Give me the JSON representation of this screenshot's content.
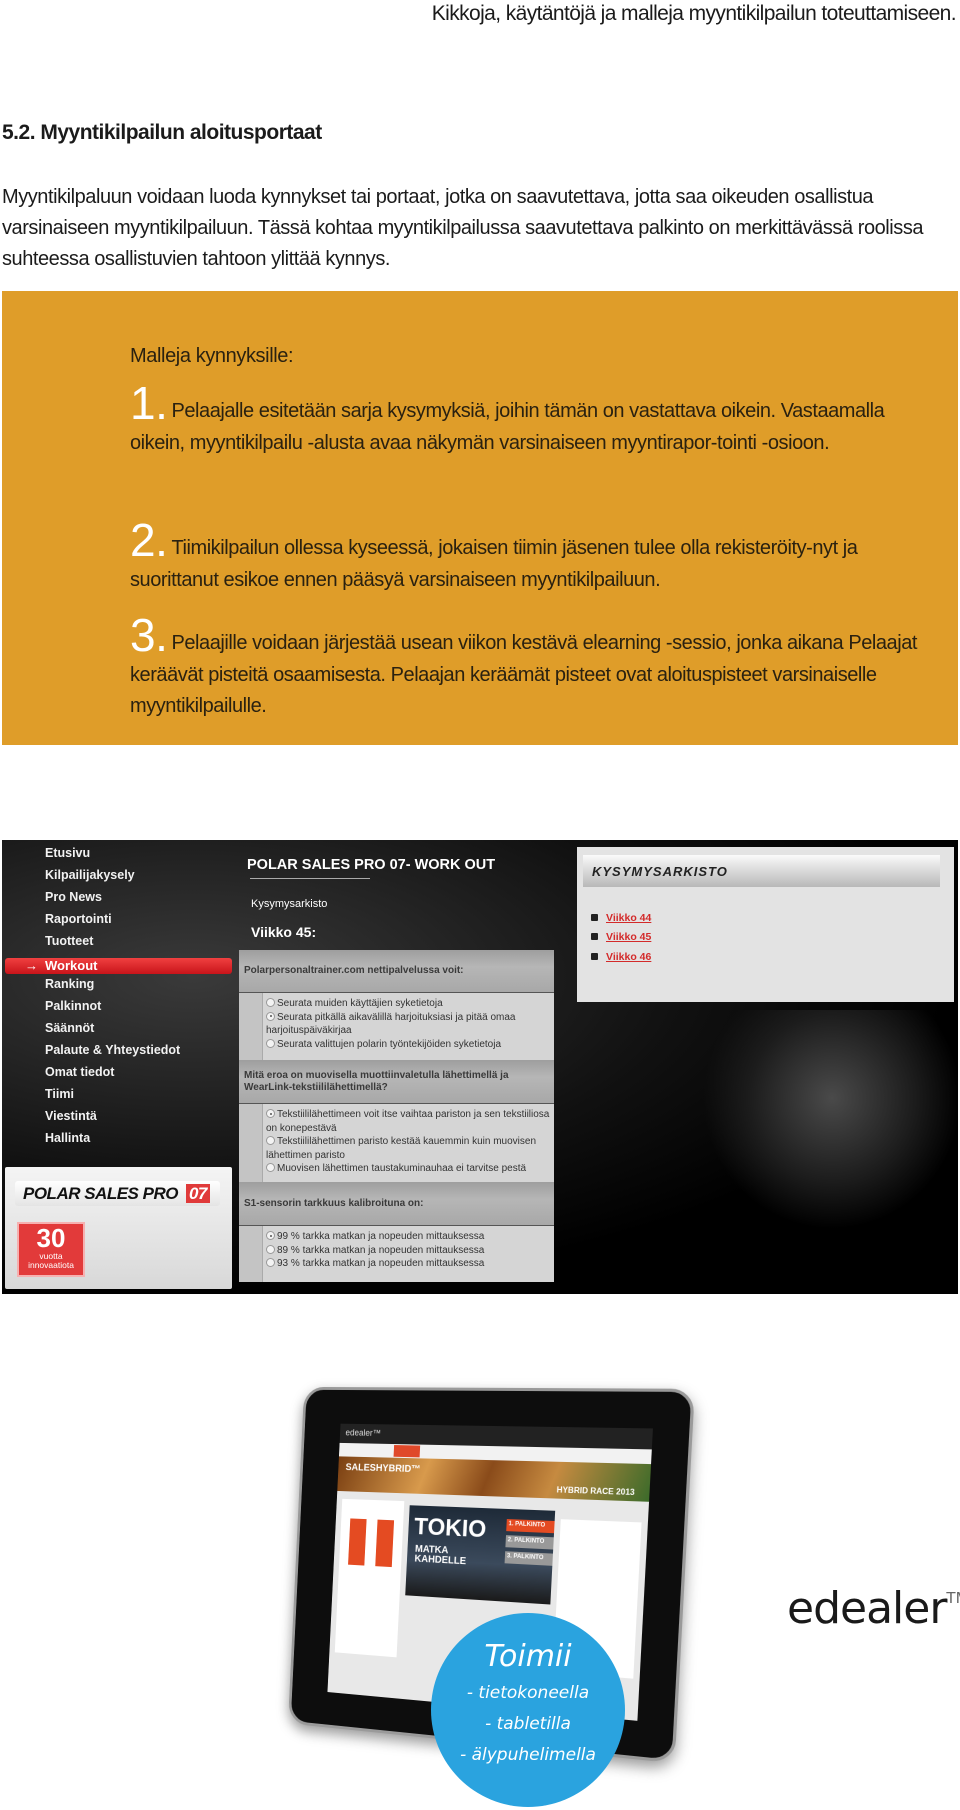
{
  "running_header": "Kikkoja, käytäntöjä ja malleja myyntikilpailun toteuttamiseen.",
  "section_heading": "5.2. Myyntikilpailun aloitusportaat",
  "intro": "Myyntikilpaluun voidaan luoda kynnykset tai portaat, jotka on saavutettava, jotta saa oikeuden osallistua varsinaiseen myyntikilpailuun. Tässä kohtaa myyntikilpailussa saavutettava palkinto on merkittävässä roolissa suhteessa osallistuvien tahtoon ylittää kynnys.",
  "box": {
    "color": "#DF9D29",
    "lead": "Malleja kynnyksille:",
    "items": [
      {
        "num": "1.",
        "text": "Pelaajalle esitetään sarja kysymyksiä, joihin tämän on vastattava oikein. Vastaamalla oikein, myyntikilpailu -alusta avaa näkymän varsinaiseen myyntirapor-tointi -osioon."
      },
      {
        "num": "2.",
        "text": "Tiimikilpailun ollessa kyseessä, jokaisen tiimin jäsenen tulee olla rekisteröity-nyt ja suorittanut esikoe ennen pääsyä varsinaiseen myyntikilpailuun."
      },
      {
        "num": "3.",
        "text": "Pelaajille voidaan järjestää usean viikon kestävä elearning -sessio, jonka aikana Pelaajat keräävät pisteitä osaamisesta. Pelaajan keräämät pisteet ovat aloituspisteet varsinaiselle myyntikilpailulle."
      }
    ]
  },
  "polar": {
    "nav": [
      "Etusivu",
      "Kilpailijakysely",
      "Pro News",
      "Raportointi",
      "Tuotteet",
      "Workout",
      "Ranking",
      "Palkinnot",
      "Säännöt",
      "Palaute & Yhteystiedot",
      "Omat tiedot",
      "Tiimi",
      "Viestintä",
      "Hallinta"
    ],
    "active_nav": "Workout",
    "active_arrow": "→",
    "logo_text": "POLAR SALES PRO",
    "logo_num": "07",
    "badge_num": "30",
    "badge_line1": "vuotta",
    "badge_line2": "innovaatiota",
    "title": "POLAR SALES PRO 07- WORK OUT",
    "subtitle": "Kysymysarkisto",
    "week": "Viikko 45:",
    "questions": [
      {
        "q": "Polarpersonaltrainer.com nettipalvelussa voit:",
        "options": [
          "Seurata muiden käyttäjien syketietoja",
          "Seurata pitkällä aikavälillä harjoituksiasi ja pitää omaa harjoituspäiväkirjaa",
          "Seurata valittujen polarin työntekijöiden syketietoja"
        ],
        "selected": 1
      },
      {
        "q": "Mitä eroa on muovisella muottiinvaletulla lähettimellä ja WearLink-tekstiililähettimellä?",
        "options": [
          "Tekstiililähettimeen voit itse vaihtaa pariston ja sen tekstiiliosa on konepestävä",
          "Tekstiililähettimen paristo kestää kauemmin kuin muovisen lähettimen paristo",
          "Muovisen lähettimen taustakuminauhaa ei tarvitse pestä"
        ],
        "selected": 0
      },
      {
        "q": "S1-sensorin tarkkuus kalibroituna on:",
        "options": [
          "99 % tarkka matkan ja nopeuden mittauksessa",
          "89 % tarkka matkan ja nopeuden mittauksessa",
          "93 % tarkka matkan ja nopeuden mittauksessa"
        ],
        "selected": 0
      }
    ],
    "archive_title": "KYSYMYSARKISTO",
    "archive_links": [
      "Viikko 44",
      "Viikko 45",
      "Viikko 46"
    ],
    "link_color": "#D32A2A"
  },
  "tablet": {
    "brand": "edealer™",
    "banner": "SALESHYBRID™",
    "banner_right": "HYBRID RACE 2013",
    "promo_title": "TOKIO",
    "promo_sub": "MATKA KAHDELLE",
    "prizes": [
      "1. PALKINTO",
      "2. PALKINTO",
      "3. PALKINTO"
    ],
    "bubble_title": "Toimii",
    "bubble_lines": [
      "- tietokoneella",
      "- tabletilla",
      "- älypuhelimella"
    ],
    "bubble_color": "#2AA3DF"
  },
  "logo": {
    "name": "edealer",
    "tm": "TM"
  }
}
